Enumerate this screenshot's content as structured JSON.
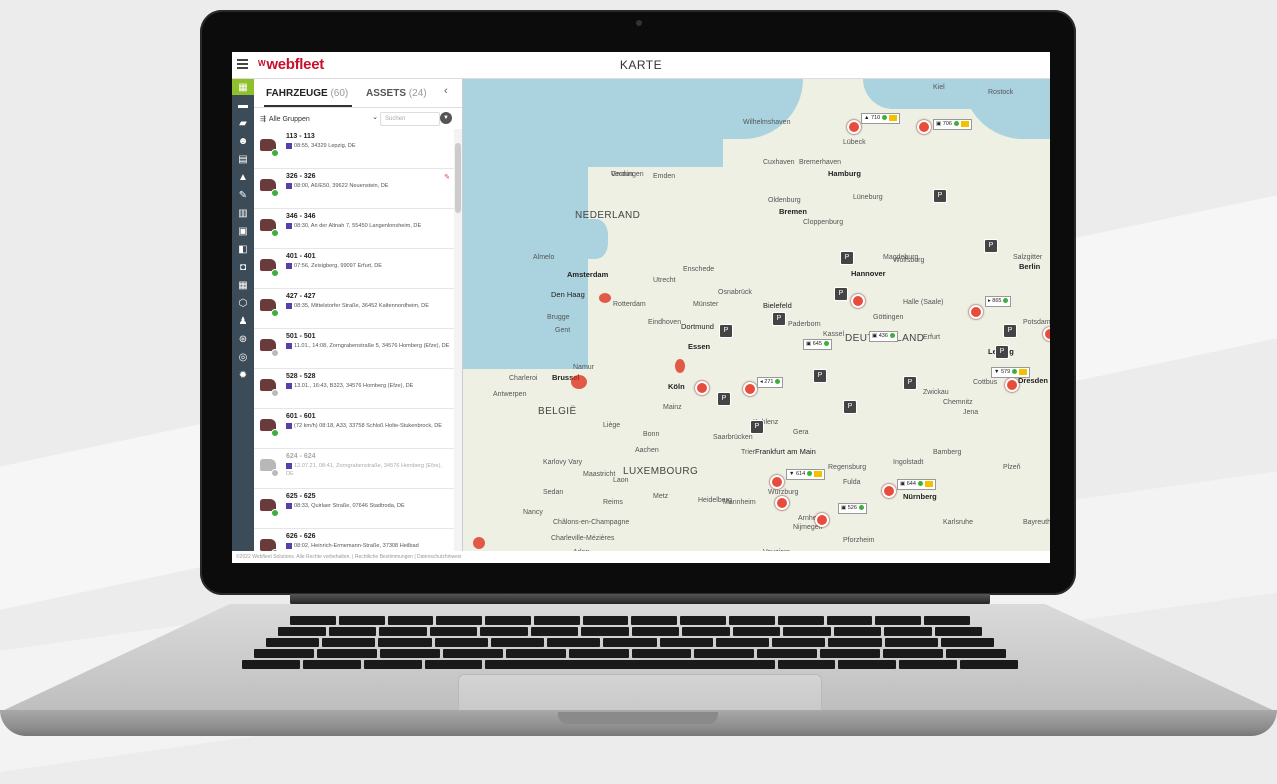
{
  "app": {
    "brand": "webfleet",
    "page_title": "KARTE"
  },
  "panel": {
    "tab_vehicles": "FAHRZEUGE",
    "tab_vehicles_count": "(60)",
    "tab_assets": "ASSETS",
    "tab_assets_count": "(24)",
    "group_select": "Alle Gruppen",
    "search_placeholder": "Suchen",
    "vehicles": [
      {
        "name": "113 - 113",
        "addr": "08:55, 34329 Lepzig, DE",
        "status": "on"
      },
      {
        "name": "326 - 326",
        "addr": "08:00, A6/E50, 39622 Neuenstein, DE",
        "status": "on",
        "wrench": true
      },
      {
        "name": "346 - 346",
        "addr": "08:30, An der Altnah 7, 55450 Langenlonsheim, DE",
        "status": "on"
      },
      {
        "name": "401 - 401",
        "addr": "07:56, Zeisigberg, 99097 Erfurt, DE",
        "status": "on"
      },
      {
        "name": "427 - 427",
        "addr": "08:35, Mittelstorfer Straße, 36452 Kaltennordheim, DE",
        "status": "on"
      },
      {
        "name": "501 - 501",
        "addr": "11.01., 14:08, Zorngrabenstraße 5, 34576 Homberg (Efze), DE",
        "status": "off"
      },
      {
        "name": "528 - 528",
        "addr": "13.01., 16:43, B323, 34576 Homberg (Efze), DE",
        "status": "off"
      },
      {
        "name": "601 - 601",
        "addr": "(72 km/h) 08:18, A33, 33758 Schloß Holte-Stukenbrock, DE",
        "status": "on"
      },
      {
        "name": "624 - 624",
        "addr": "12.07.21, 08:41, Zorngrabenstraße, 34576 Homberg (Efze), DE",
        "status": "off",
        "faded": true
      },
      {
        "name": "625 - 625",
        "addr": "08:33, Quirlaer Straße, 07646 Stadtroda, DE",
        "status": "on"
      },
      {
        "name": "626 - 626",
        "addr": "08:02, Heinrich-Ermemann-Straße, 37308 Heilbad Heiligenstadt, DE",
        "status": "on"
      }
    ]
  },
  "footer": {
    "copyright": "©2022 Webfleet Solutions. Alle Rechte vorbehalten.",
    "legal": "Rechtliche Bestimmungen",
    "privacy": "Datenschutzhinweis"
  },
  "map": {
    "countries": [
      "NEDERLAND",
      "BELGIË",
      "LUXEMBOURG",
      "DEUTSCHLAND"
    ],
    "cities": [
      "Amsterdam",
      "Den Haag",
      "Brussel",
      "Hamburg",
      "Essen",
      "Köln",
      "Frankfurt am Main",
      "Nürnberg",
      "Bremen",
      "Leipzig",
      "Dresden",
      "Hannover",
      "Bielefeld",
      "Dortmund",
      "Berlin"
    ],
    "towns": [
      "Groningen",
      "Emden",
      "Wilhelmshaven",
      "Lübeck",
      "Kiel",
      "Rostock",
      "Cuxhaven",
      "Bremerhaven",
      "Lüneburg",
      "Oldenburg",
      "Cloppenburg",
      "Almelo",
      "Enschede",
      "Osnabrück",
      "Münster",
      "Paderborn",
      "Kassel",
      "Göttingen",
      "Erfurt",
      "Halle (Saale)",
      "Magdeburg",
      "Wolfsburg",
      "Salzgitter",
      "Potsdam",
      "Cottbus",
      "Chemnitz",
      "Zwickau",
      "Jena",
      "Gera",
      "Fulda",
      "Würzburg",
      "Mannheim",
      "Heidelberg",
      "Saarbrücken",
      "Trier",
      "Koblenz",
      "Mainz",
      "Bonn",
      "Aachen",
      "Maastricht",
      "Liège",
      "Namur",
      "Charleroi",
      "Antwerpen",
      "Gent",
      "Brugge",
      "Rotterdam",
      "Utrecht",
      "Eindhoven",
      "Nijmegen",
      "Arnhem",
      "Karlsruhe",
      "Pforzheim",
      "Regensburg",
      "Ingolstadt",
      "Bamberg",
      "Bayreuth",
      "Plzeň",
      "Karlovy Vary",
      "Metz",
      "Nancy",
      "Reims",
      "Châlons-en-Champagne",
      "Charleville-Mézières",
      "Sedan",
      "Arlon",
      "Laon",
      "Vouziers",
      "Verdun"
    ],
    "vehicle_tags": [
      "710",
      "706",
      "865",
      "436",
      "645",
      "271",
      "579",
      "614",
      "644",
      "526"
    ]
  },
  "colors": {
    "brand": "#c8102e",
    "sidebar": "#3b4b57",
    "active": "#8fbf2a",
    "marker": "#e74c3c"
  }
}
